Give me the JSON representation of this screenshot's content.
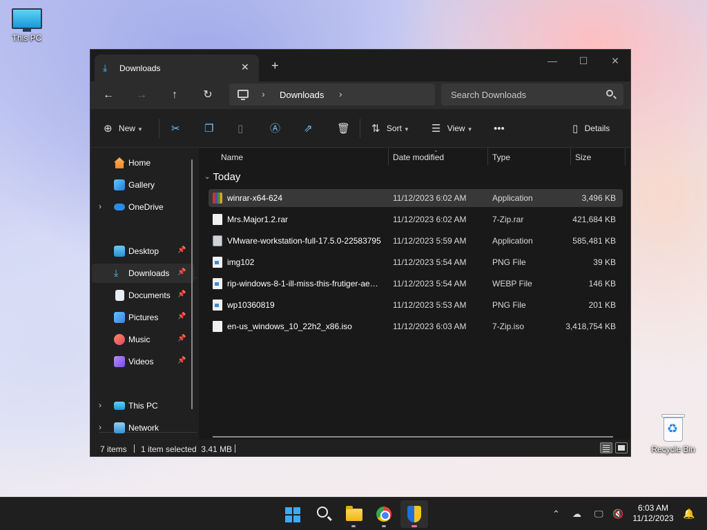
{
  "desktop": {
    "this_pc_label": "This PC",
    "recycle_bin_label": "Recycle Bin"
  },
  "window": {
    "tab_title": "Downloads",
    "breadcrumb_current": "Downloads",
    "search_placeholder": "Search Downloads"
  },
  "toolbar": {
    "new_label": "New",
    "sort_label": "Sort",
    "view_label": "View",
    "details_label": "Details"
  },
  "nav": {
    "items": [
      {
        "label": "Home"
      },
      {
        "label": "Gallery"
      },
      {
        "label": "OneDrive"
      },
      {
        "label": "Desktop"
      },
      {
        "label": "Downloads"
      },
      {
        "label": "Documents"
      },
      {
        "label": "Pictures"
      },
      {
        "label": "Music"
      },
      {
        "label": "Videos"
      },
      {
        "label": "This PC"
      },
      {
        "label": "Network"
      }
    ]
  },
  "columns": {
    "name": "Name",
    "date": "Date modified",
    "type": "Type",
    "size": "Size"
  },
  "group_label": "Today",
  "files": [
    {
      "name": "winrar-x64-624",
      "date": "11/12/2023 6:02 AM",
      "type": "Application",
      "size": "3,496 KB",
      "icon": "winrar-icon"
    },
    {
      "name": "Mrs.Major1.2.rar",
      "date": "11/12/2023 6:02 AM",
      "type": "7-Zip.rar",
      "size": "421,684 KB",
      "icon": "file-icon"
    },
    {
      "name": "VMware-workstation-full-17.5.0-22583795",
      "date": "11/12/2023 5:59 AM",
      "type": "Application",
      "size": "585,481 KB",
      "icon": "vmware-icon"
    },
    {
      "name": "img102",
      "date": "11/12/2023 5:54 AM",
      "type": "PNG File",
      "size": "39 KB",
      "icon": "image-file-icon"
    },
    {
      "name": "rip-windows-8-1-ill-miss-this-frutiger-ae…",
      "date": "11/12/2023 5:54 AM",
      "type": "WEBP File",
      "size": "146 KB",
      "icon": "image-file-icon"
    },
    {
      "name": "wp10360819",
      "date": "11/12/2023 5:53 AM",
      "type": "PNG File",
      "size": "201 KB",
      "icon": "image-file-icon"
    },
    {
      "name": "en-us_windows_10_22h2_x86.iso",
      "date": "11/12/2023 6:03 AM",
      "type": "7-Zip.iso",
      "size": "3,418,754 KB",
      "icon": "file-icon"
    }
  ],
  "status": {
    "item_count": "7 items",
    "selection": "1 item selected  3.41 MB"
  },
  "taskbar": {
    "time": "6:03 AM",
    "date": "11/12/2023"
  },
  "colors": {
    "accent": "#4cc2ff",
    "window_bg": "#202020",
    "selection_bg": "#383838"
  }
}
